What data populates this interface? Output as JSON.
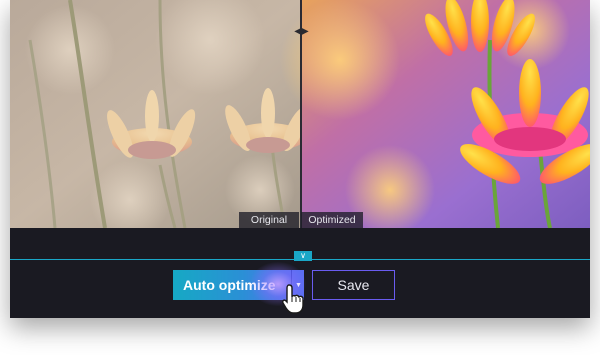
{
  "photo": {
    "left_label": "Original",
    "right_label": "Optimized"
  },
  "toolbar": {
    "auto_optimize_label": "Auto optimize",
    "save_label": "Save"
  },
  "icons": {
    "compare_handle": "left-right-arrows-icon",
    "collapse_toggle": "chevron-down-icon",
    "dropdown": "caret-down-icon",
    "cursor": "hand-pointer-icon"
  },
  "colors": {
    "accent": "#1aa7c8",
    "save_border": "#6a5cf0",
    "panel_bg": "#1a1a22"
  }
}
